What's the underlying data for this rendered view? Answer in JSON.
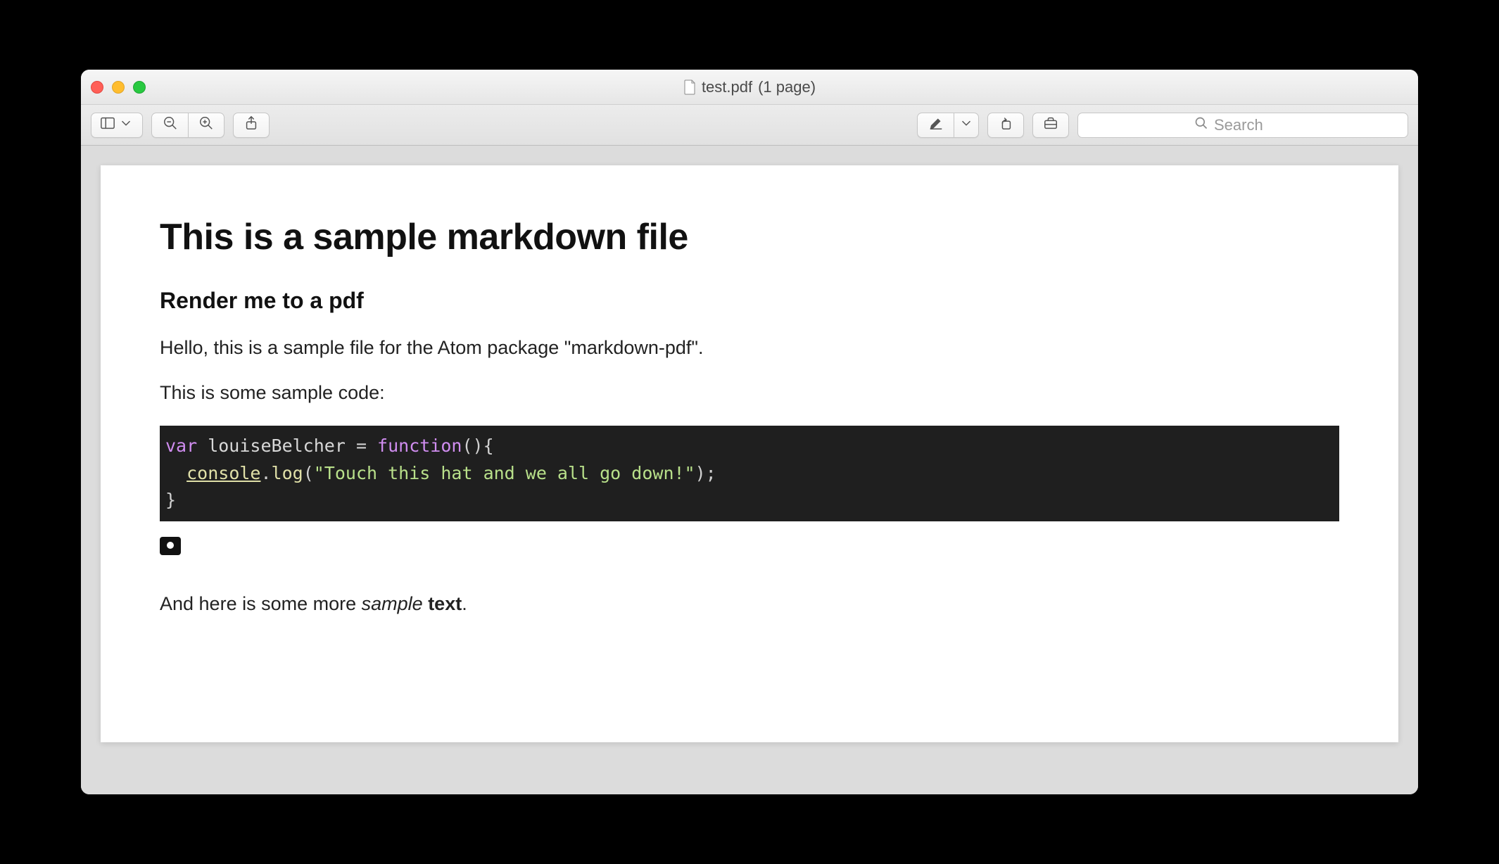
{
  "window": {
    "title_filename": "test.pdf",
    "title_suffix": "(1 page)",
    "traffic_lights": [
      "close",
      "minimize",
      "zoom"
    ]
  },
  "toolbar": {
    "view_icon": "sidebar-toggle-icon",
    "zoom_out_icon": "zoom-out-icon",
    "zoom_in_icon": "zoom-in-icon",
    "share_icon": "share-icon",
    "markup_icon": "markup-pen-icon",
    "markup_chevron_icon": "chevron-down-icon",
    "rotate_icon": "rotate-left-icon",
    "toolbox_icon": "toolbox-icon"
  },
  "search": {
    "placeholder": "Search"
  },
  "document": {
    "h1": "This is a sample markdown file",
    "h2": "Render me to a pdf",
    "p1": "Hello, this is a sample file for the Atom package \"markdown-pdf\".",
    "p2": "This is some sample code:",
    "code": {
      "line1_var": "var",
      "line1_ident": " louiseBelcher ",
      "line1_eq": "= ",
      "line1_func_kw": "function",
      "line1_tail": "(){",
      "line2_indent": "  ",
      "line2_console": "console",
      "line2_dot": ".",
      "line2_log": "log",
      "line2_open": "(",
      "line2_string": "\"Touch this hat and we all go down!\"",
      "line2_close": ");",
      "line3": "}"
    },
    "image_placeholder_icon": "camera-icon",
    "p3_prefix": "And here is some more ",
    "p3_italic": "sample",
    "p3_space": " ",
    "p3_bold": "text",
    "p3_suffix": "."
  }
}
